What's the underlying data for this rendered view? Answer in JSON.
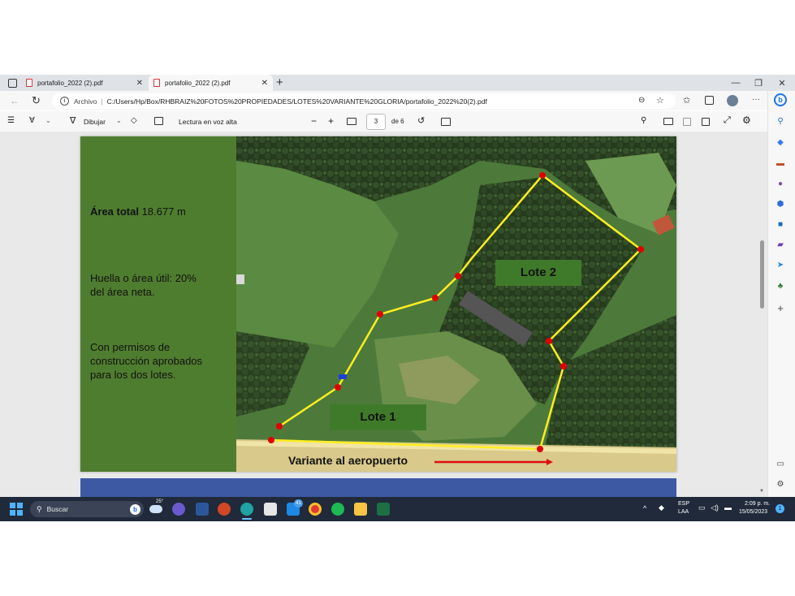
{
  "browser": {
    "tabs": [
      {
        "title": "portafolio_2022 (2).pdf",
        "close": "✕"
      },
      {
        "title": "portafolio_2022 (2).pdf",
        "close": "✕"
      }
    ],
    "new_tab": "+",
    "window_controls": {
      "minimize": "—",
      "restore": "❐",
      "close": "✕"
    },
    "address": {
      "scheme_label": "Archivo",
      "separator": "|",
      "url": "C:/Users/Hp/Box/RHBRAIZ%20FOTOS%20PROPIEDADES/LOTES%20VARIANTE%20GLORIA/portafolio_2022%20(2).pdf"
    },
    "more": "···"
  },
  "pdf_toolbar": {
    "draw_label": "Dibujar",
    "read_aloud_label": "Lectura en voz alta",
    "zoom_out": "−",
    "zoom_in": "+",
    "page_current": "3",
    "page_total": "de 6"
  },
  "slide": {
    "area_total_bold": "Área total",
    "area_total_value": " 18.677 m",
    "huella_line1": "Huella o área útil: 20%",
    "huella_line2": "del área neta.",
    "permisos_line1": "Con permisos de",
    "permisos_line2": "construcción aprobados",
    "permisos_line3": "para los dos lotes.",
    "lote1_label": "Lote 1",
    "lote2_label": "Lote 2",
    "road_label": "Variante al aeropuerto"
  },
  "taskbar": {
    "search_label": "Buscar",
    "weather_temp": "25°",
    "chat_badge": "41",
    "lang_line1": "ESP",
    "lang_line2": "LAA",
    "time": "2:09 p. m.",
    "date": "15/05/2023",
    "notif_badge": "1"
  },
  "colors": {
    "slide_green": "#4f7d2f",
    "label_green": "#3f7a2a",
    "boundary_yellow": "#ffee22",
    "marker_red": "#e00000",
    "arrow_red": "#e01010",
    "taskbar_bg": "#202a3a",
    "next_page_blue": "#3e59a4"
  }
}
